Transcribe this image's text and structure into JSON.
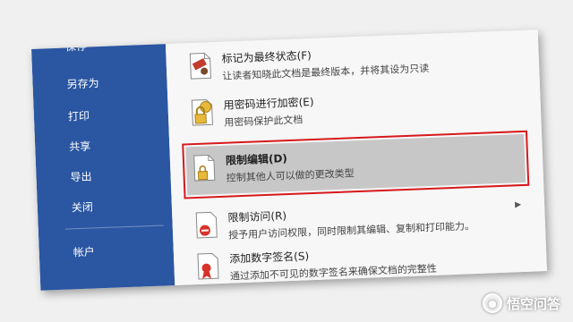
{
  "sidebar": {
    "items": [
      {
        "label": "保存"
      },
      {
        "label": "另存为"
      },
      {
        "label": "打印"
      },
      {
        "label": "共享"
      },
      {
        "label": "导出"
      },
      {
        "label": "关闭"
      },
      {
        "label": "帐户"
      }
    ],
    "background": "#2a56a2"
  },
  "options": [
    {
      "title": "标记为最终状态(F)",
      "desc": "让读者知晓此文档是最终版本，并将其设为只读",
      "icon": "stamp-icon"
    },
    {
      "title": "用密码进行加密(E)",
      "desc": "用密码保护此文档",
      "icon": "key-lock-icon"
    },
    {
      "title": "限制编辑(D)",
      "desc": "控制其他人可以做的更改类型",
      "icon": "document-lock-icon",
      "selected": true
    },
    {
      "title": "限制访问(R)",
      "desc": "授予用户访问权限，同时限制其编辑、复制和打印能力。",
      "icon": "restrict-access-icon",
      "has_arrow": true
    },
    {
      "title": "添加数字签名(S)",
      "desc": "通过添加不可见的数字签名来确保文档的完整性",
      "icon": "ribbon-icon"
    }
  ],
  "highlight_color": "#d7191c",
  "watermark": {
    "text": "悟空问答"
  }
}
